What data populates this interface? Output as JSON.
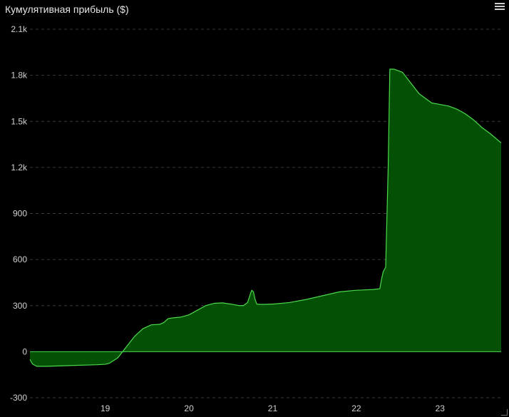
{
  "panel": {
    "title": "Кумулятивная прибыль ($)"
  },
  "chart_data": {
    "type": "area",
    "title": "Кумулятивная прибыль ($)",
    "xlabel": "",
    "ylabel": "",
    "ylim": [
      -300,
      2100
    ],
    "xlim": [
      18.1,
      23.73
    ],
    "grid": true,
    "y_ticks": [
      {
        "value": 2100,
        "label": "2.1k"
      },
      {
        "value": 1800,
        "label": "1.8k"
      },
      {
        "value": 1500,
        "label": "1.5k"
      },
      {
        "value": 1200,
        "label": "1.2k"
      },
      {
        "value": 900,
        "label": "900"
      },
      {
        "value": 600,
        "label": "600"
      },
      {
        "value": 300,
        "label": "300"
      },
      {
        "value": 0,
        "label": "0"
      },
      {
        "value": -300,
        "label": "-300"
      }
    ],
    "x_ticks": [
      {
        "value": 19,
        "label": "19"
      },
      {
        "value": 20,
        "label": "20"
      },
      {
        "value": 21,
        "label": "21"
      },
      {
        "value": 22,
        "label": "22"
      },
      {
        "value": 23,
        "label": "23"
      }
    ],
    "line_color": "#4cd94c",
    "fill_color": "#045004",
    "series": [
      {
        "x": [
          18.1,
          18.13,
          18.18,
          18.3,
          18.6,
          18.9,
          19.0,
          19.05,
          19.15,
          19.25,
          19.35,
          19.45,
          19.55,
          19.65,
          19.7,
          19.75,
          19.8,
          19.9,
          20.0,
          20.1,
          20.2,
          20.3,
          20.4,
          20.5,
          20.6,
          20.65,
          20.7,
          20.73,
          20.75,
          20.77,
          20.79,
          20.81,
          20.85,
          20.9,
          21.0,
          21.2,
          21.4,
          21.6,
          21.8,
          22.0,
          22.2,
          22.28,
          22.3,
          22.32,
          22.35,
          22.38,
          22.4,
          22.45,
          22.55,
          22.65,
          22.75,
          22.9,
          23.0,
          23.1,
          23.2,
          23.3,
          23.4,
          23.5,
          23.6,
          23.73
        ],
        "y": [
          -50,
          -80,
          -95,
          -95,
          -90,
          -85,
          -82,
          -75,
          -40,
          30,
          100,
          150,
          175,
          178,
          190,
          215,
          220,
          225,
          240,
          270,
          300,
          315,
          318,
          310,
          300,
          300,
          320,
          370,
          400,
          390,
          340,
          310,
          308,
          308,
          310,
          320,
          340,
          365,
          390,
          400,
          405,
          410,
          470,
          520,
          550,
          1200,
          1840,
          1840,
          1820,
          1750,
          1680,
          1620,
          1610,
          1600,
          1580,
          1550,
          1510,
          1460,
          1420,
          1360
        ]
      }
    ]
  }
}
